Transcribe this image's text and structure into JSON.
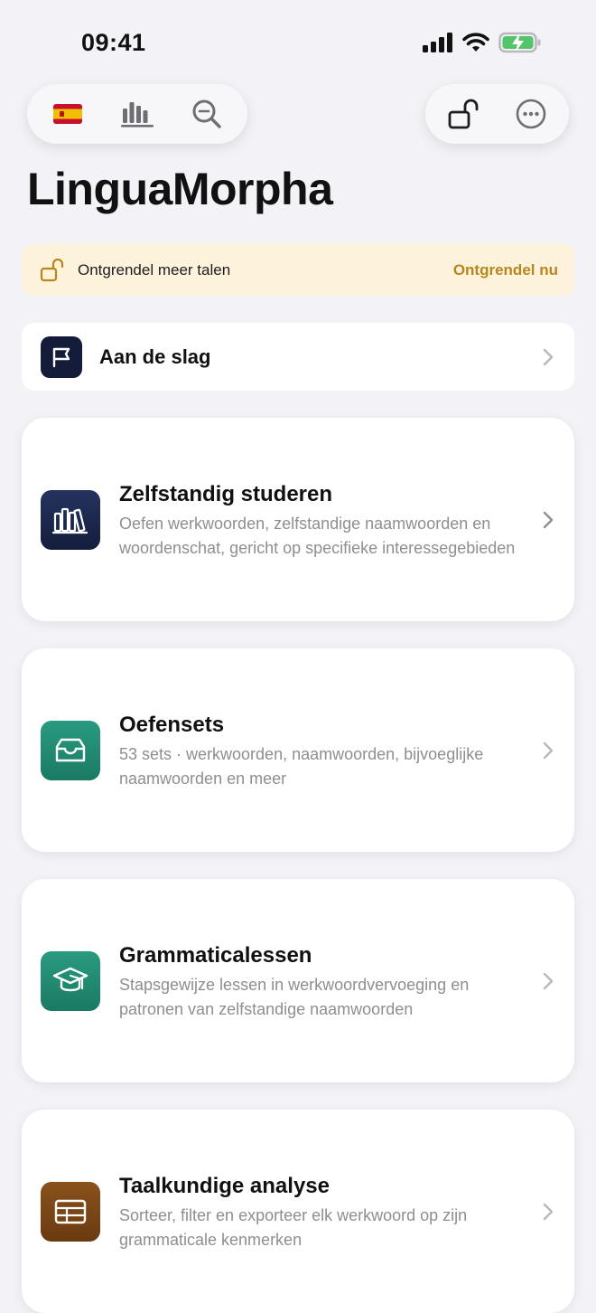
{
  "status": {
    "time": "09:41"
  },
  "toolbar": {
    "left": [
      "spain-flag-icon",
      "chart-icon",
      "search-zoom-icon"
    ],
    "right": [
      "unlock-icon",
      "more-icon"
    ]
  },
  "app_title": "LinguaMorpha",
  "banner": {
    "text": "Ontgrendel meer talen",
    "action": "Ontgrendel nu",
    "accent": "#b8861c",
    "background": "#fdf2dc"
  },
  "get_started": {
    "label": "Aan de slag",
    "icon": "flag-icon"
  },
  "cards": [
    {
      "title": "Zelfstandig studeren",
      "description": "Oefen werkwoorden, zelfstandige naamwoorden en woordenschat, gericht op specifieke interessegebieden",
      "icon": "books-icon",
      "color": "#1b2a52"
    },
    {
      "title": "Oefensets",
      "description": "53 sets · werkwoorden, naamwoorden, bijvoeglijke naamwoorden en meer",
      "icon": "inbox-tray-icon",
      "color": "#1f8a70"
    },
    {
      "title": "Grammaticalessen",
      "description": "Stapsgewijze lessen in werkwoordvervoeging en patronen van zelfstandige naamwoorden",
      "icon": "graduation-cap-icon",
      "color": "#1f8a70"
    },
    {
      "title": "Taalkundige analyse",
      "description": "Sorteer, filter en exporteer elk werkwoord op zijn grammaticale kenmerken",
      "icon": "table-icon",
      "color": "#7a4514"
    }
  ]
}
